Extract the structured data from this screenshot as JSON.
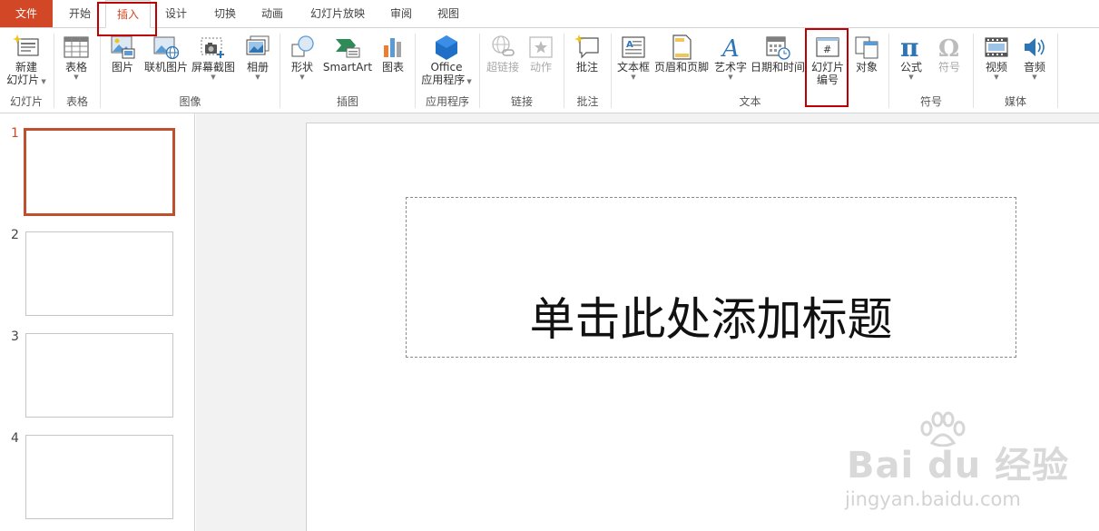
{
  "tabs": [
    "文件",
    "开始",
    "插入",
    "设计",
    "切换",
    "动画",
    "幻灯片放映",
    "审阅",
    "视图"
  ],
  "ribbon": {
    "new_slide": {
      "line1": "新建",
      "line2": "幻灯片"
    },
    "table": "表格",
    "picture": "图片",
    "online_picture": "联机图片",
    "screenshot": "屏幕截图",
    "album": "相册",
    "shape": "形状",
    "smartart": "SmartArt",
    "chart": "图表",
    "office_apps": {
      "line1": "Office",
      "line2": "应用程序"
    },
    "hyperlink": "超链接",
    "action": "动作",
    "comment": "批注",
    "textbox": "文本框",
    "header_footer": "页眉和页脚",
    "wordart": "艺术字",
    "datetime": "日期和时间",
    "slide_number": {
      "line1": "幻灯片",
      "line2": "编号"
    },
    "object": "对象",
    "equation": "公式",
    "symbol": "符号",
    "video": "视频",
    "audio": "音频"
  },
  "groups": [
    "幻灯片",
    "表格",
    "图像",
    "插图",
    "应用程序",
    "链接",
    "批注",
    "文本",
    "符号",
    "媒体"
  ],
  "slides": [
    "1",
    "2",
    "3",
    "4"
  ],
  "title_placeholder": "单击此处添加标题",
  "watermark": {
    "logo": "Bai du 经验",
    "url": "jingyan.baidu.com"
  },
  "colors": {
    "accent": "#d24726",
    "highlight": "#c00000"
  }
}
